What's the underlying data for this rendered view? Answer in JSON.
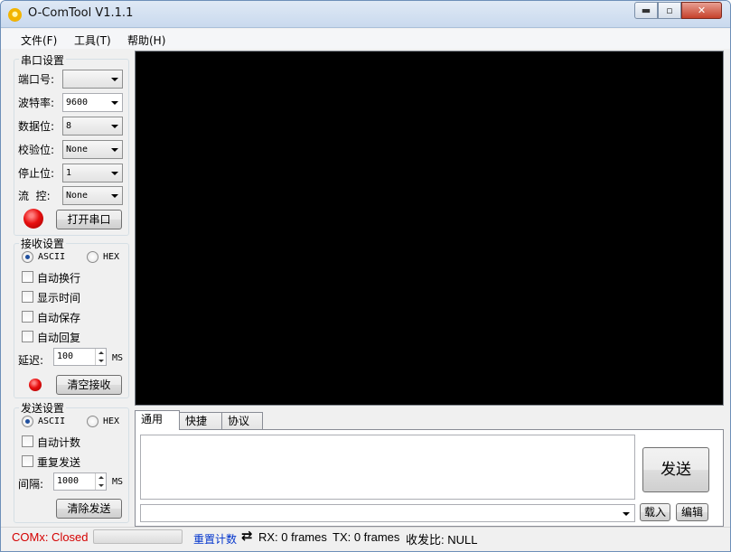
{
  "window": {
    "title": "O-ComTool V1.1.1",
    "min_glyph": "▬",
    "max_glyph": "▫",
    "close_glyph": "✕"
  },
  "menu": {
    "file": "文件(F)",
    "tools": "工具(T)",
    "help": "帮助(H)"
  },
  "serial": {
    "group_title": "串口设置",
    "port_label": "端口号:",
    "port_value": "",
    "baud_label": "波特率:",
    "baud_value": "9600",
    "databits_label": "数据位:",
    "databits_value": "8",
    "parity_label": "校验位:",
    "parity_value": "None",
    "stopbits_label": "停止位:",
    "stopbits_value": "1",
    "flow_label": "流  控:",
    "flow_value": "None",
    "open_button": "打开串口",
    "led_color": "#e01010"
  },
  "receive": {
    "group_title": "接收设置",
    "ascii_label": "ASCII",
    "hex_label": "HEX",
    "mode": "ASCII",
    "auto_newline": "自动换行",
    "show_time": "显示时间",
    "auto_save": "自动保存",
    "auto_reply": "自动回复",
    "delay_label": "延迟:",
    "delay_value": "100",
    "delay_unit": "MS",
    "clear_button": "清空接收"
  },
  "send": {
    "group_title": "发送设置",
    "ascii_label": "ASCII",
    "hex_label": "HEX",
    "mode": "ASCII",
    "auto_count": "自动计数",
    "repeat_send": "重复发送",
    "interval_label": "间隔:",
    "interval_value": "1000",
    "interval_unit": "MS",
    "clear_button": "清除发送"
  },
  "tabs": [
    "通用",
    "快捷",
    "协议"
  ],
  "send_area": {
    "text": "",
    "send_button": "发送",
    "load_button": "载入",
    "edit_button": "编辑"
  },
  "status": {
    "com_status": "COMx: Closed",
    "reset_count": "重置计数",
    "rx": "RX: 0 frames",
    "tx": "TX: 0 frames",
    "ratio": "收发比: NULL",
    "closed_color": "#d40000",
    "link_color": "#0033cc"
  }
}
